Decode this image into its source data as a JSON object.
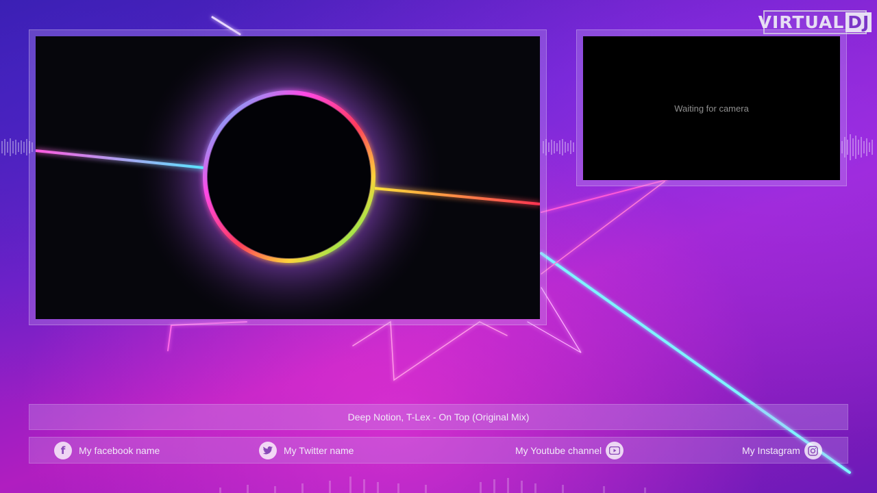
{
  "logo": {
    "virtual": "VIRTUAL",
    "dj": "DJ"
  },
  "camera": {
    "status": "Waiting for camera"
  },
  "now_playing": {
    "title": "Deep Notion, T-Lex - On Top (Original Mix)"
  },
  "social": {
    "facebook": "My facebook name",
    "twitter": "My Twitter name",
    "youtube": "My Youtube channel",
    "instagram": "My Instagram"
  },
  "icons": {
    "facebook": "facebook-icon",
    "twitter": "twitter-icon",
    "youtube": "youtube-icon",
    "instagram": "instagram-icon"
  }
}
